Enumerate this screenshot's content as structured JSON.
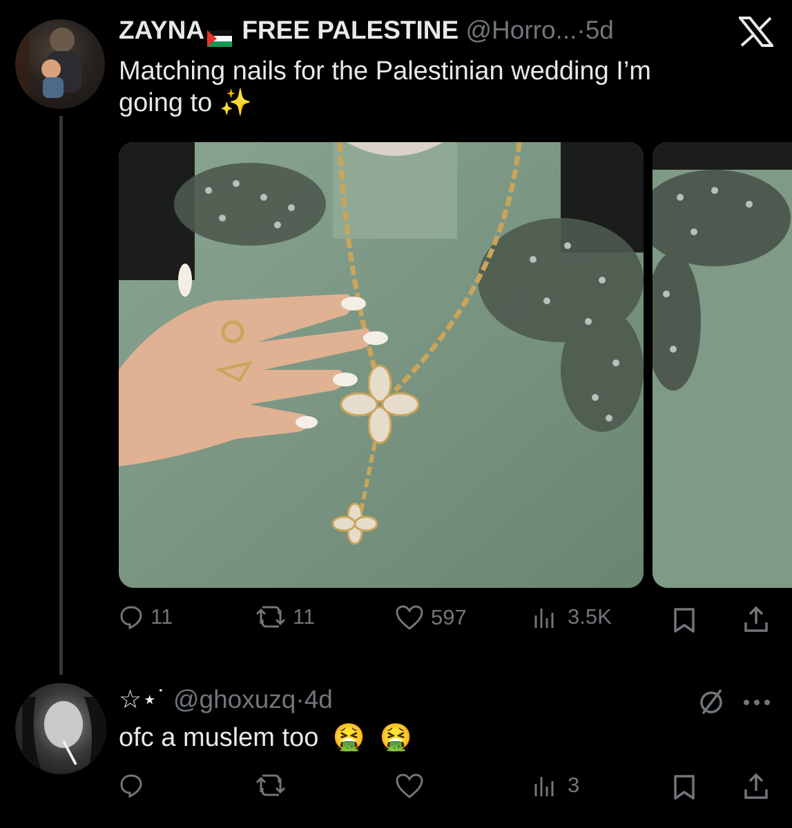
{
  "main_tweet": {
    "display_name": "ZAYNA",
    "name_suffix": "FREE PALESTINE",
    "handle": "@Horro...",
    "separator": "·",
    "time": "5d",
    "text_line1": "Matching nails for the Palestinian wedding I’m",
    "text_line2": "going to",
    "sparkles": "✨",
    "actions": {
      "replies": "11",
      "retweets": "11",
      "likes": "597",
      "views": "3.5K"
    }
  },
  "reply_tweet": {
    "display_name": "☆⋆˙",
    "handle": "@ghoxuzq",
    "separator": "·",
    "time": "4d",
    "text": "ofc a muslem too",
    "emojis": [
      "🤮",
      "🤮"
    ],
    "actions": {
      "views": "3"
    }
  },
  "icons": {
    "logo": "x-logo-icon",
    "more": "more-icon",
    "grok": "slash-circle-icon"
  },
  "colors": {
    "background": "#000000",
    "text": "#e7e9ea",
    "muted": "#71767b",
    "dress": "#7f9a86",
    "gold": "#c9a55a"
  }
}
